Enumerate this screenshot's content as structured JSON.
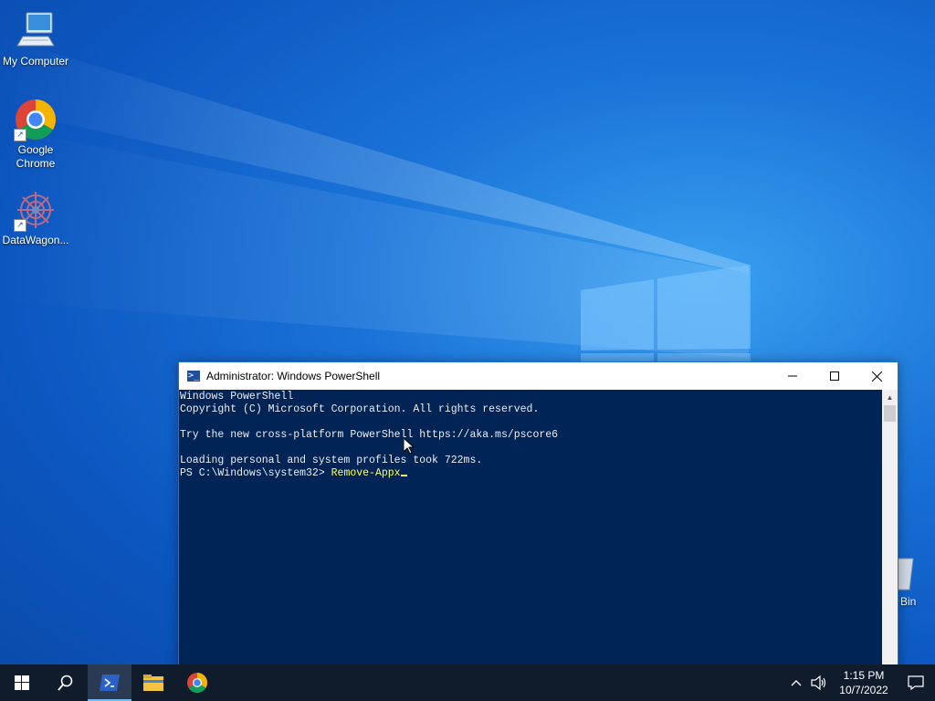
{
  "desktop": {
    "icons": [
      {
        "label": "My Computer",
        "icon": "computer-icon"
      },
      {
        "label": "Google Chrome",
        "icon": "chrome-icon"
      },
      {
        "label": "DataWagon...",
        "icon": "datawagon-icon"
      }
    ],
    "recycle_bin_label": "e Bin"
  },
  "powershell": {
    "title": "Administrator: Windows PowerShell",
    "lines": [
      "Windows PowerShell",
      "Copyright (C) Microsoft Corporation. All rights reserved.",
      "",
      "Try the new cross-platform PowerShell https://aka.ms/pscore6",
      "",
      "Loading personal and system profiles took 722ms."
    ],
    "prompt": "PS C:\\Windows\\system32> ",
    "command": "Remove-Appx"
  },
  "taskbar": {
    "time": "1:15 PM",
    "date": "10/7/2022"
  },
  "colors": {
    "console_bg": "#012456",
    "console_fg": "#eeedf0",
    "command_fg": "#ffff60",
    "taskbar_bg": "#101c2c"
  }
}
